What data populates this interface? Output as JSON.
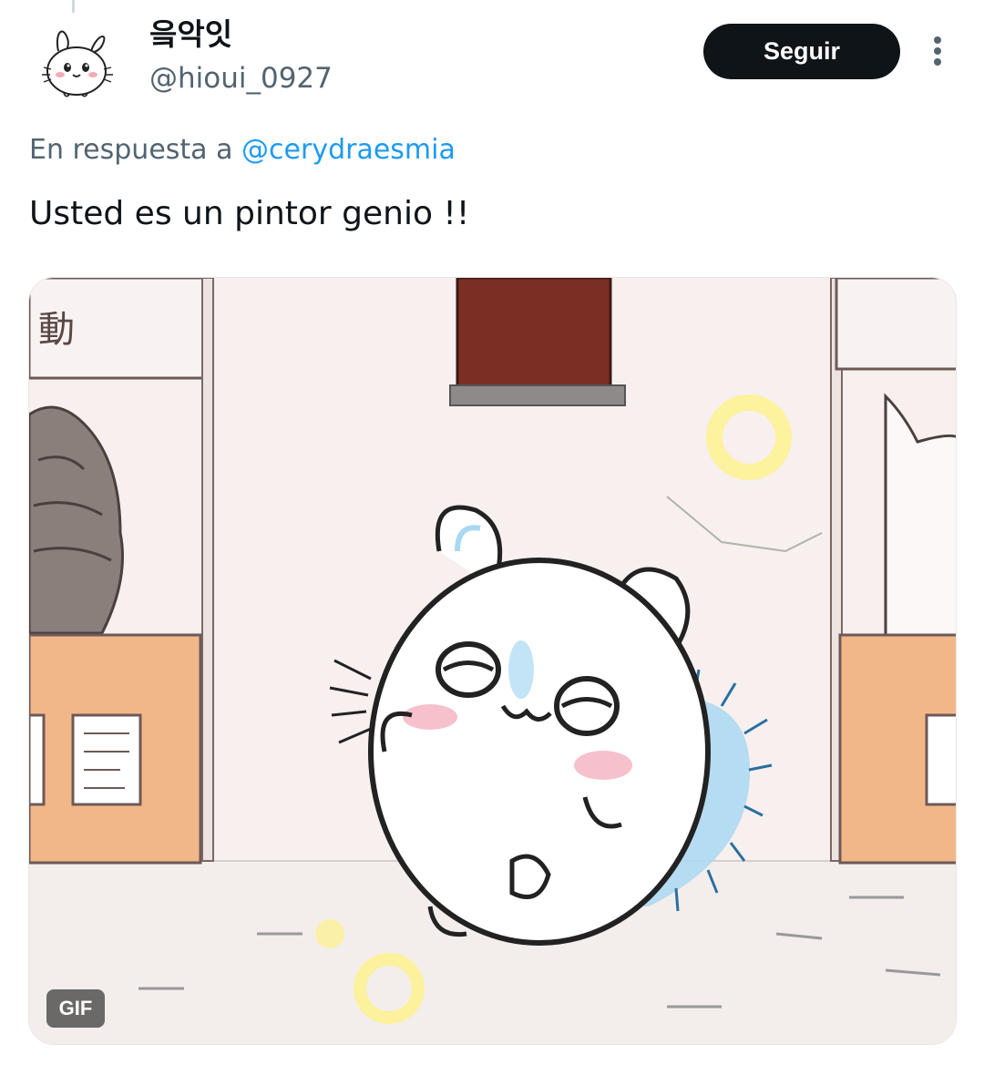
{
  "user": {
    "display_name": "읔악잇",
    "handle": "@hioui_0927",
    "avatar_icon": "chiikawa-rabbit-avatar"
  },
  "header": {
    "follow_label": "Seguir",
    "more_icon": "more-vertical-icon"
  },
  "reply": {
    "prefix": "En respuesta a",
    "mention": "@cerydraesmia"
  },
  "tweet": {
    "text": "Usted es un pintor genio !!"
  },
  "media": {
    "type": "gif",
    "badge": "GIF"
  },
  "colors": {
    "text_primary": "#0f1419",
    "text_secondary": "#536471",
    "link": "#1d9bf0",
    "button_bg": "#0f1419"
  }
}
